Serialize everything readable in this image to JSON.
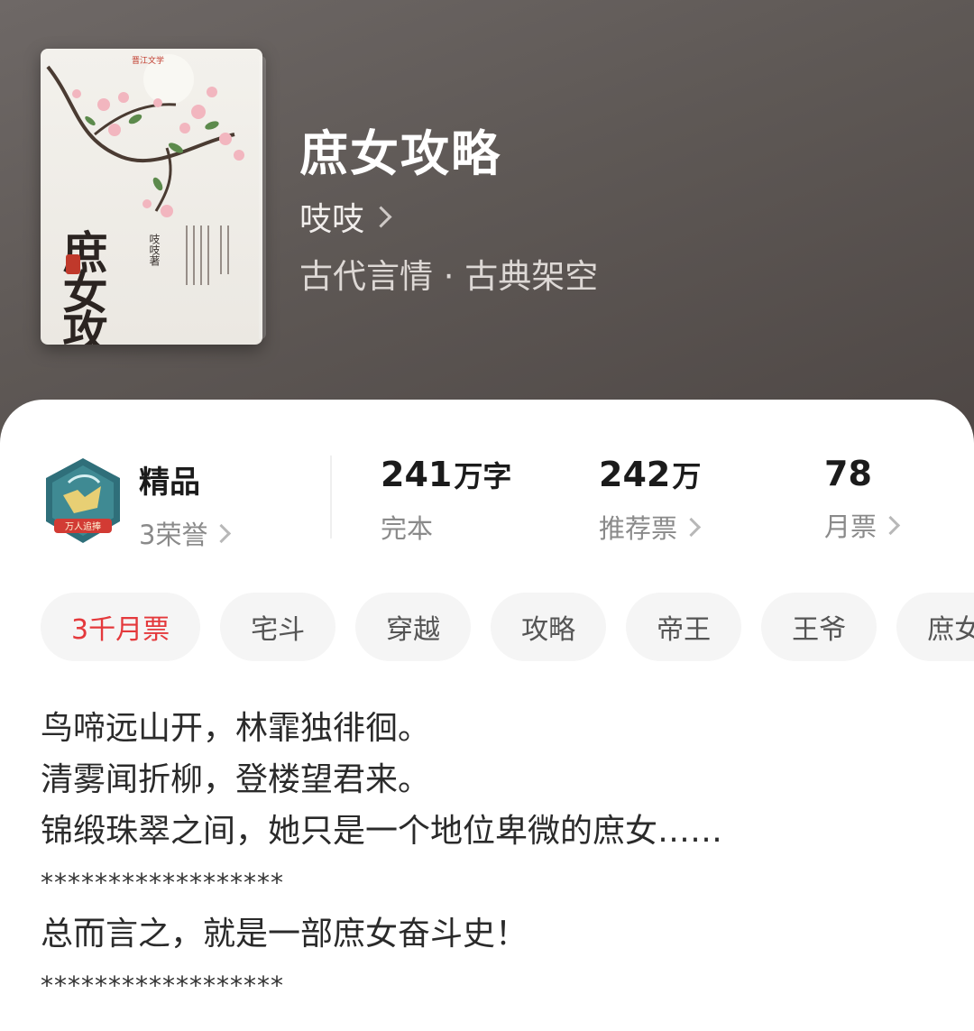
{
  "book": {
    "title": "庶女攻略",
    "author": "吱吱",
    "genre": "古代言情 · 古典架空",
    "cover": {
      "title_vertical": "庶女攻略",
      "author_mark": "吱吱著",
      "publisher_mark": "晋江文学"
    }
  },
  "stats": {
    "quality": {
      "label": "精品",
      "honors": "3荣誉",
      "badge_text": "万人追捧"
    },
    "words": {
      "value": "241",
      "unit": "万字",
      "status": "完本"
    },
    "recommend": {
      "value": "242",
      "unit": "万",
      "label": "推荐票"
    },
    "monthly": {
      "value": "78",
      "label": "月票"
    }
  },
  "tags": [
    "3千月票",
    "宅斗",
    "穿越",
    "攻略",
    "帝王",
    "王爷",
    "庶女"
  ],
  "description": [
    "鸟啼远山开，林霏独徘徊。",
    "清雾闻折柳，登楼望君来。",
    "锦缎珠翠之间，她只是一个地位卑微的庶女……",
    "******************",
    "总而言之，就是一部庶女奋斗史！",
    "******************"
  ],
  "colors": {
    "accent_red": "#e4393c",
    "hero_bg": "#5e5855",
    "badge_teal": "#2f6f7a"
  }
}
